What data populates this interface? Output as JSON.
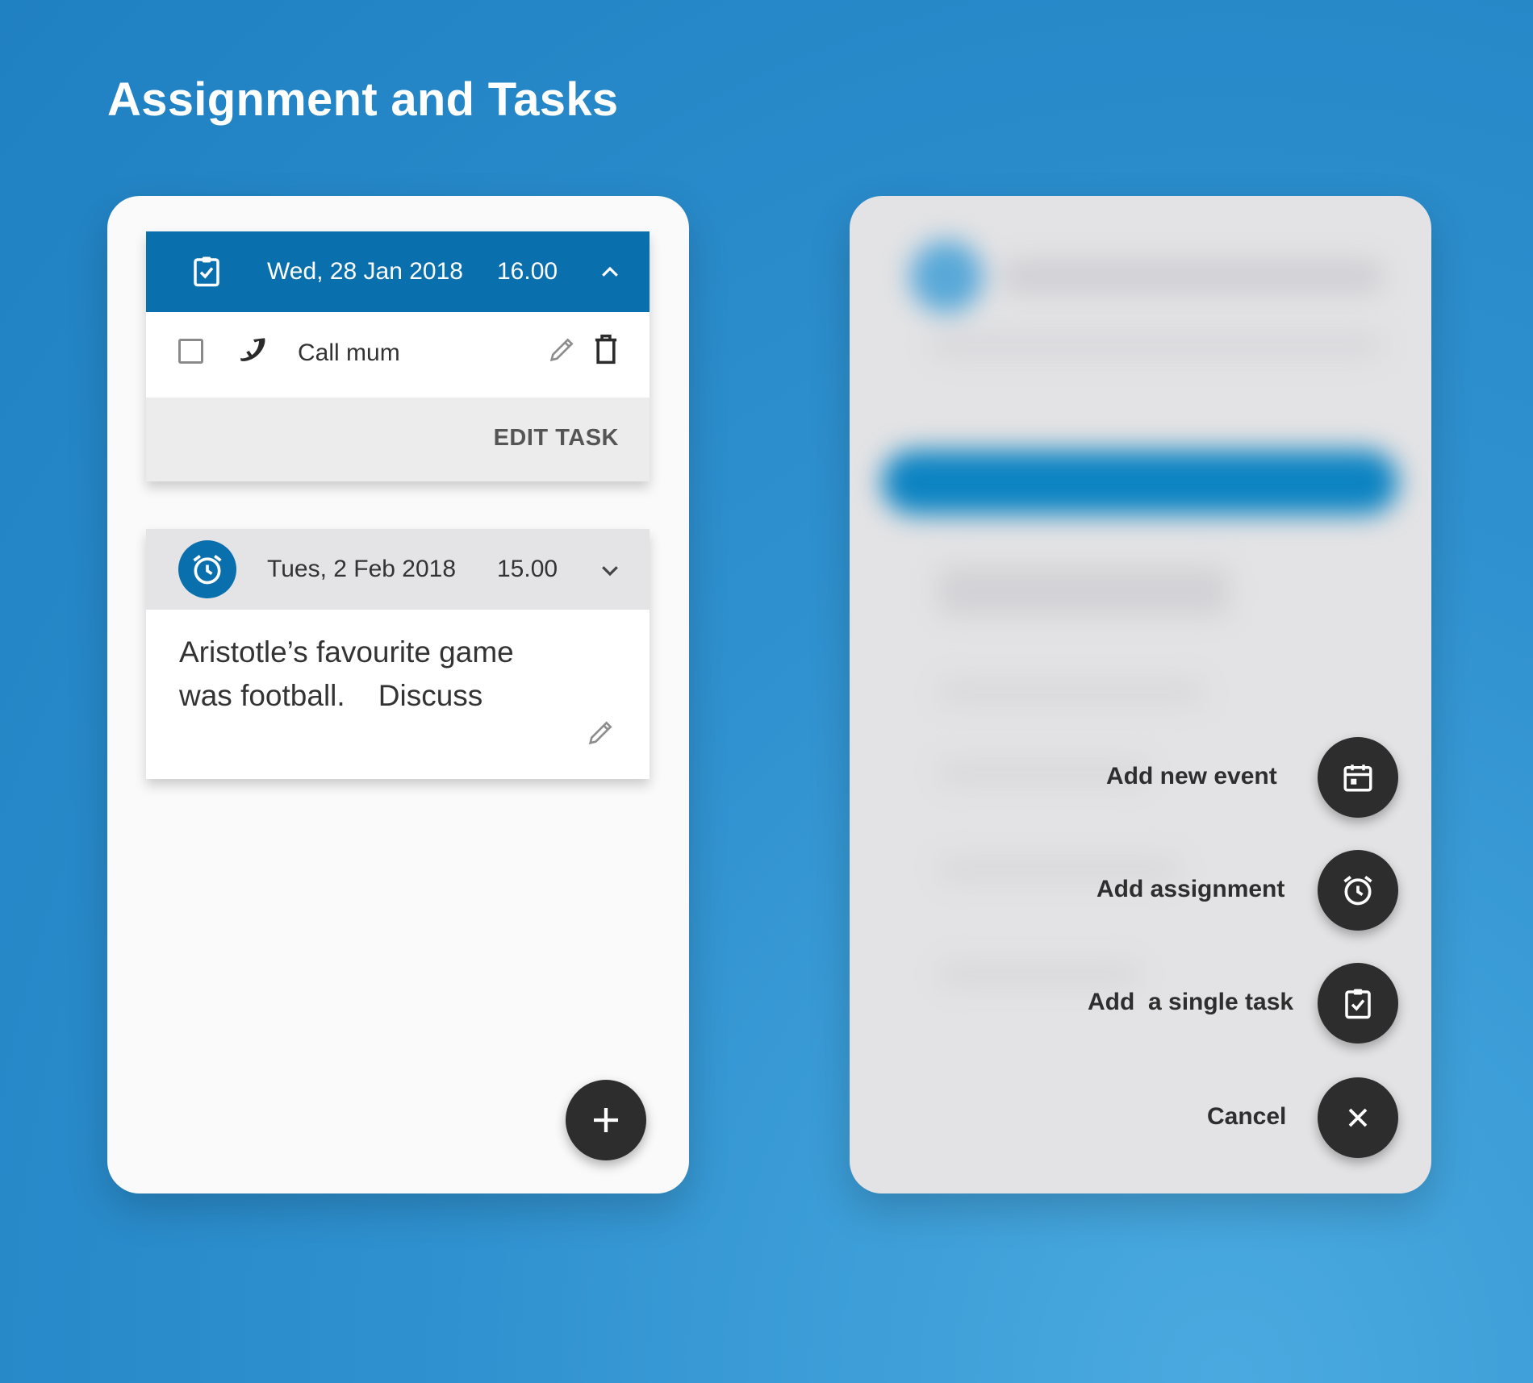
{
  "title": "Assignment and Tasks",
  "colors": {
    "primary": "#0a6fad",
    "fab": "#2d2d2d",
    "background": "#2f91cf"
  },
  "task_card": {
    "header_icon": "clipboard-check-icon",
    "date": "Wed, 28 Jan 2018",
    "time": "16.00",
    "chevron_icon": "chevron-up-icon",
    "task": {
      "checked": false,
      "icon": "phone-icon",
      "label": "Call mum"
    },
    "footer_action": "EDIT TASK"
  },
  "assignment_card": {
    "header_icon": "alarm-clock-icon",
    "date": "Tues, 2 Feb 2018",
    "time": "15.00",
    "chevron_icon": "chevron-down-icon",
    "body_line1": "Aristotle’s favourite game",
    "body_line2": "was football.    Discuss"
  },
  "fab_icon": "plus-icon",
  "speed_dial": {
    "items": [
      {
        "label": "Add new event",
        "icon": "calendar-icon"
      },
      {
        "label": "Add assignment",
        "icon": "alarm-clock-icon"
      },
      {
        "label": "Add  a single task",
        "icon": "clipboard-check-icon"
      },
      {
        "label": "Cancel",
        "icon": "close-icon"
      }
    ]
  }
}
